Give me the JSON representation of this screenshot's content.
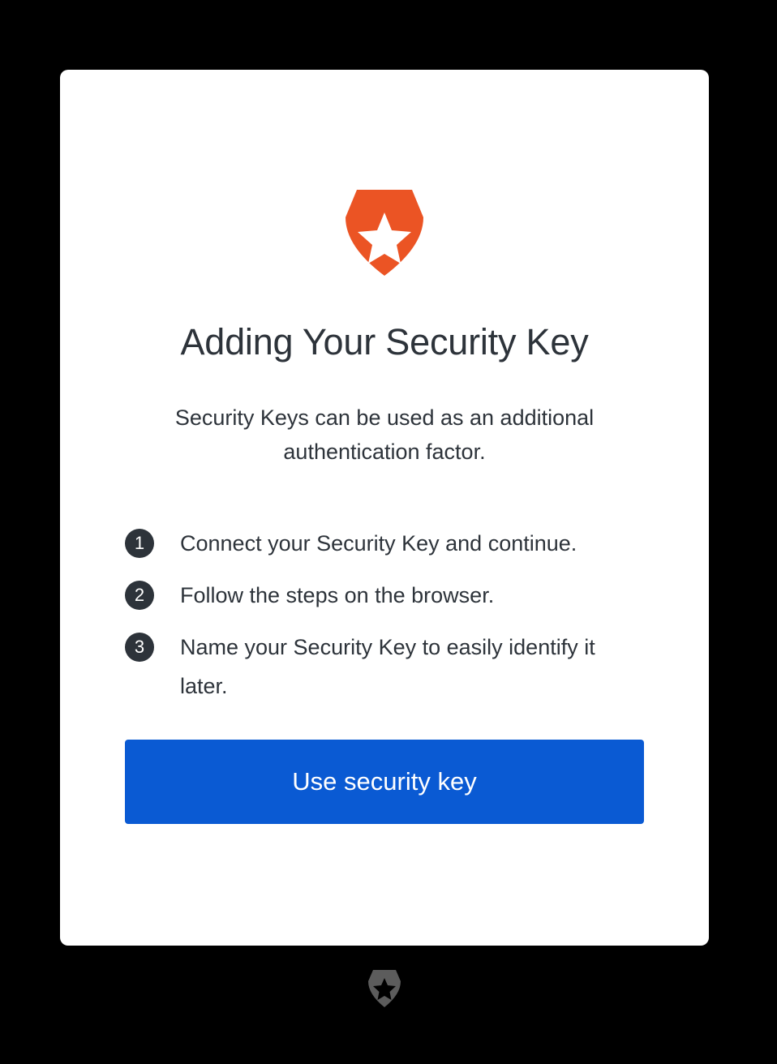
{
  "brand": {
    "logo_icon": "auth0-shield-star-icon",
    "accent_color": "#eb5424"
  },
  "card": {
    "title": "Adding Your Security Key",
    "description": "Security Keys can be used as an additional authentication factor.",
    "steps": [
      {
        "number": "1",
        "text": "Connect your Security Key and continue."
      },
      {
        "number": "2",
        "text": "Follow the steps on the browser."
      },
      {
        "number": "3",
        "text": "Name your Security Key to easily identify it later."
      }
    ],
    "button_label": "Use security key",
    "button_color": "#0a5ad3"
  },
  "footer": {
    "logo_icon": "auth0-shield-star-icon"
  }
}
